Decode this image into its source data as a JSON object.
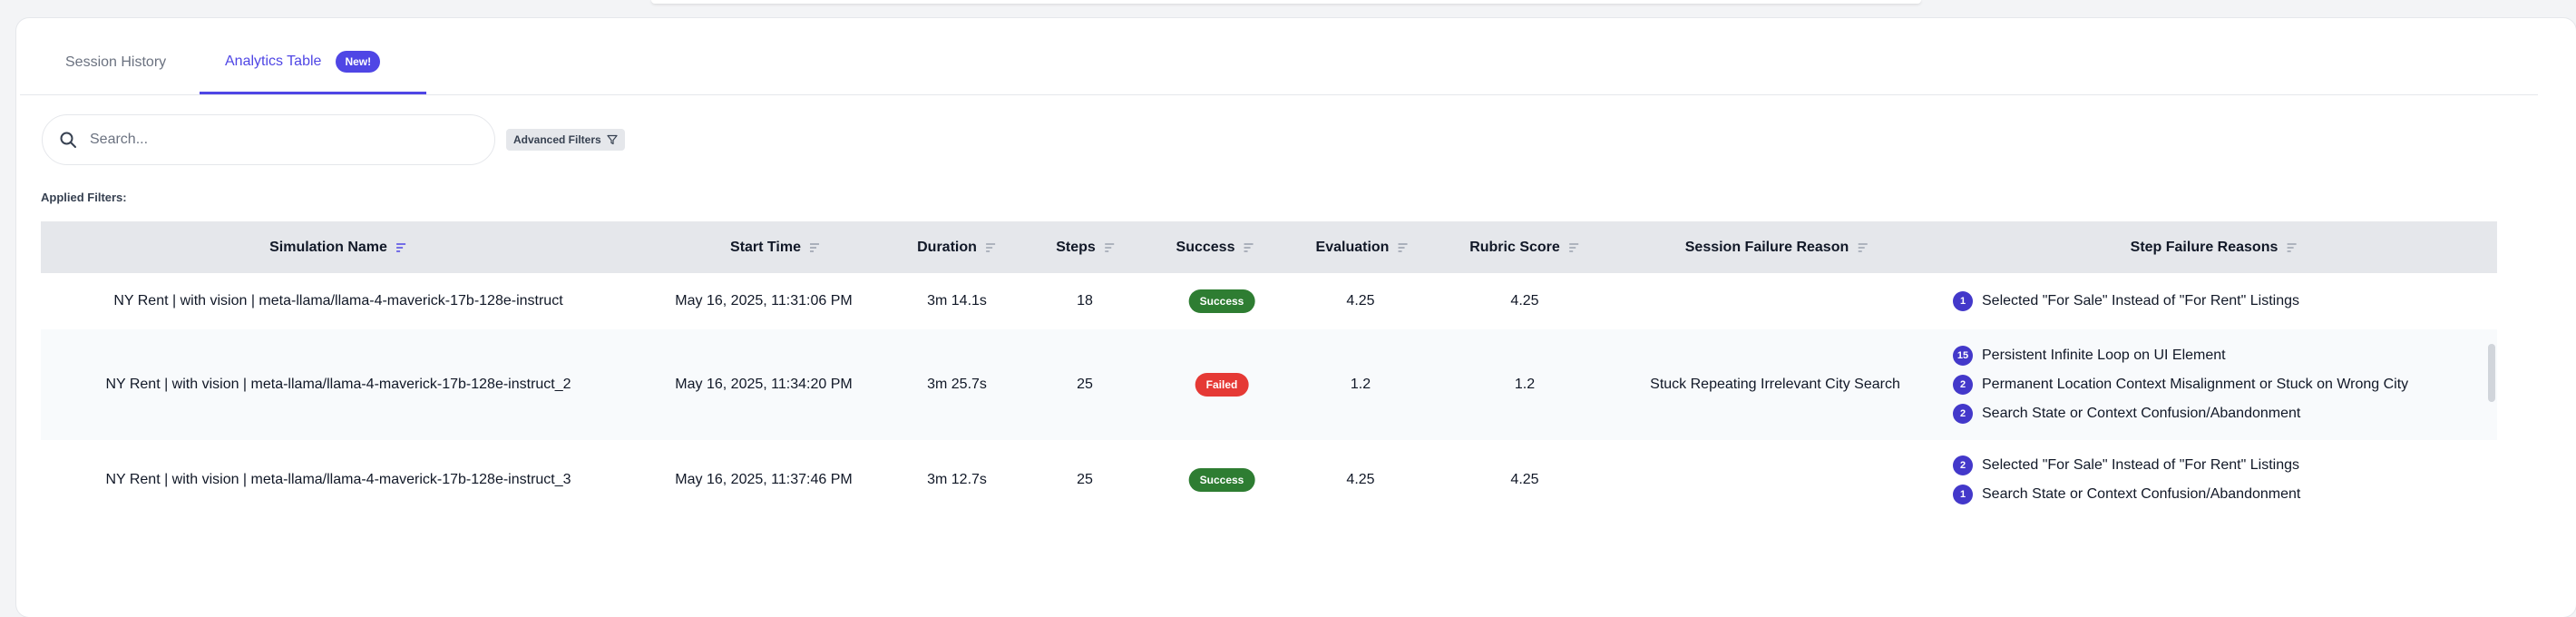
{
  "tabs": [
    {
      "label": "Session History",
      "active": false
    },
    {
      "label": "Analytics Table",
      "active": true,
      "badge": "New!"
    }
  ],
  "search": {
    "placeholder": "Search...",
    "value": ""
  },
  "filters": {
    "advanced_label": "Advanced Filters",
    "applied_label": "Applied Filters:"
  },
  "table": {
    "columns": [
      "Simulation Name",
      "Start Time",
      "Duration",
      "Steps",
      "Success",
      "Evaluation",
      "Rubric Score",
      "Session Failure Reason",
      "Step Failure Reasons"
    ],
    "rows": [
      {
        "name": "NY Rent | with vision | meta-llama/llama-4-maverick-17b-128e-instruct",
        "start_time": "May 16, 2025, 11:31:06 PM",
        "duration": "3m 14.1s",
        "steps": "18",
        "success": "Success",
        "evaluation": "4.25",
        "rubric": "4.25",
        "session_failure": "",
        "step_failures": [
          {
            "count": "1",
            "reason": "Selected \"For Sale\" Instead of \"For Rent\" Listings"
          }
        ]
      },
      {
        "name": "NY Rent | with vision | meta-llama/llama-4-maverick-17b-128e-instruct_2",
        "start_time": "May 16, 2025, 11:34:20 PM",
        "duration": "3m 25.7s",
        "steps": "25",
        "success": "Failed",
        "evaluation": "1.2",
        "rubric": "1.2",
        "session_failure": "Stuck Repeating Irrelevant City Search",
        "step_failures": [
          {
            "count": "15",
            "reason": "Persistent Infinite Loop on UI Element"
          },
          {
            "count": "2",
            "reason": "Permanent Location Context Misalignment or Stuck on Wrong City"
          },
          {
            "count": "2",
            "reason": "Search State or Context Confusion/Abandonment"
          }
        ]
      },
      {
        "name": "NY Rent | with vision | meta-llama/llama-4-maverick-17b-128e-instruct_3",
        "start_time": "May 16, 2025, 11:37:46 PM",
        "duration": "3m 12.7s",
        "steps": "25",
        "success": "Success",
        "evaluation": "4.25",
        "rubric": "4.25",
        "session_failure": "",
        "step_failures": [
          {
            "count": "2",
            "reason": "Selected \"For Sale\" Instead of \"For Rent\" Listings"
          },
          {
            "count": "1",
            "reason": "Search State or Context Confusion/Abandonment"
          }
        ]
      }
    ]
  },
  "icons": {
    "search": "search-icon",
    "filter": "funnel-icon",
    "sort": "sort-icon"
  },
  "colors": {
    "accent": "#4f46e5",
    "success": "#2e7d32",
    "failed": "#e53935",
    "header_bg": "#e5e7eb"
  }
}
